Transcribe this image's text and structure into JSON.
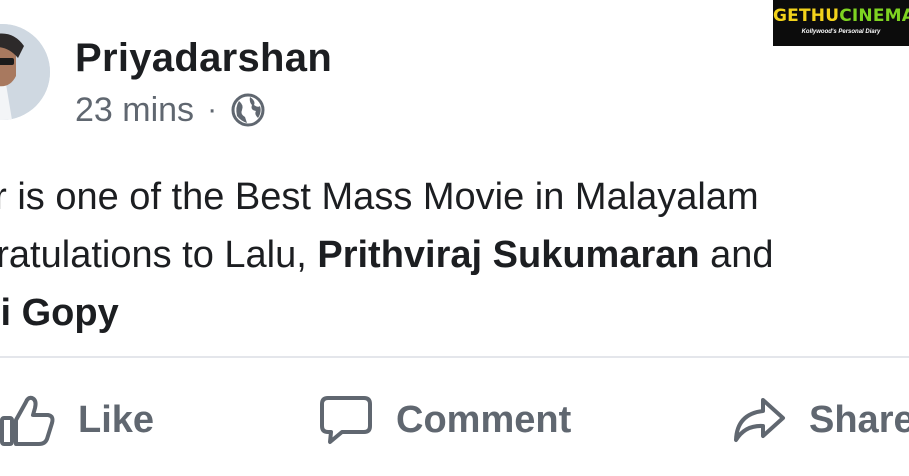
{
  "post": {
    "author": "Priyadarshan",
    "time": "23 mins",
    "separator": "·",
    "audience_icon": "globe-icon",
    "text": {
      "line1": "ifer is one of the Best Mass Movie in Malayalam",
      "line2_plain": "ngratulations to Lalu, ",
      "line2_tag": "Prithviraj Sukumaran",
      "line2_after": " and",
      "line3_tag": "rali Gopy"
    }
  },
  "actions": {
    "like": {
      "label": "Like",
      "icon": "thumbs-up-icon"
    },
    "comment": {
      "label": "Comment",
      "icon": "comment-bubble-icon"
    },
    "share": {
      "label": "Share",
      "icon": "share-arrow-icon"
    }
  },
  "watermark": {
    "brand_part1": "GETHU",
    "brand_part2": "CINEMA",
    "tagline": "Kollywood's Personal Diary"
  },
  "colors": {
    "text": "#1c1e21",
    "secondary": "#606770",
    "divider": "#e4e6eb",
    "watermark_yellow": "#f2d21b",
    "watermark_green": "#7ed321"
  }
}
